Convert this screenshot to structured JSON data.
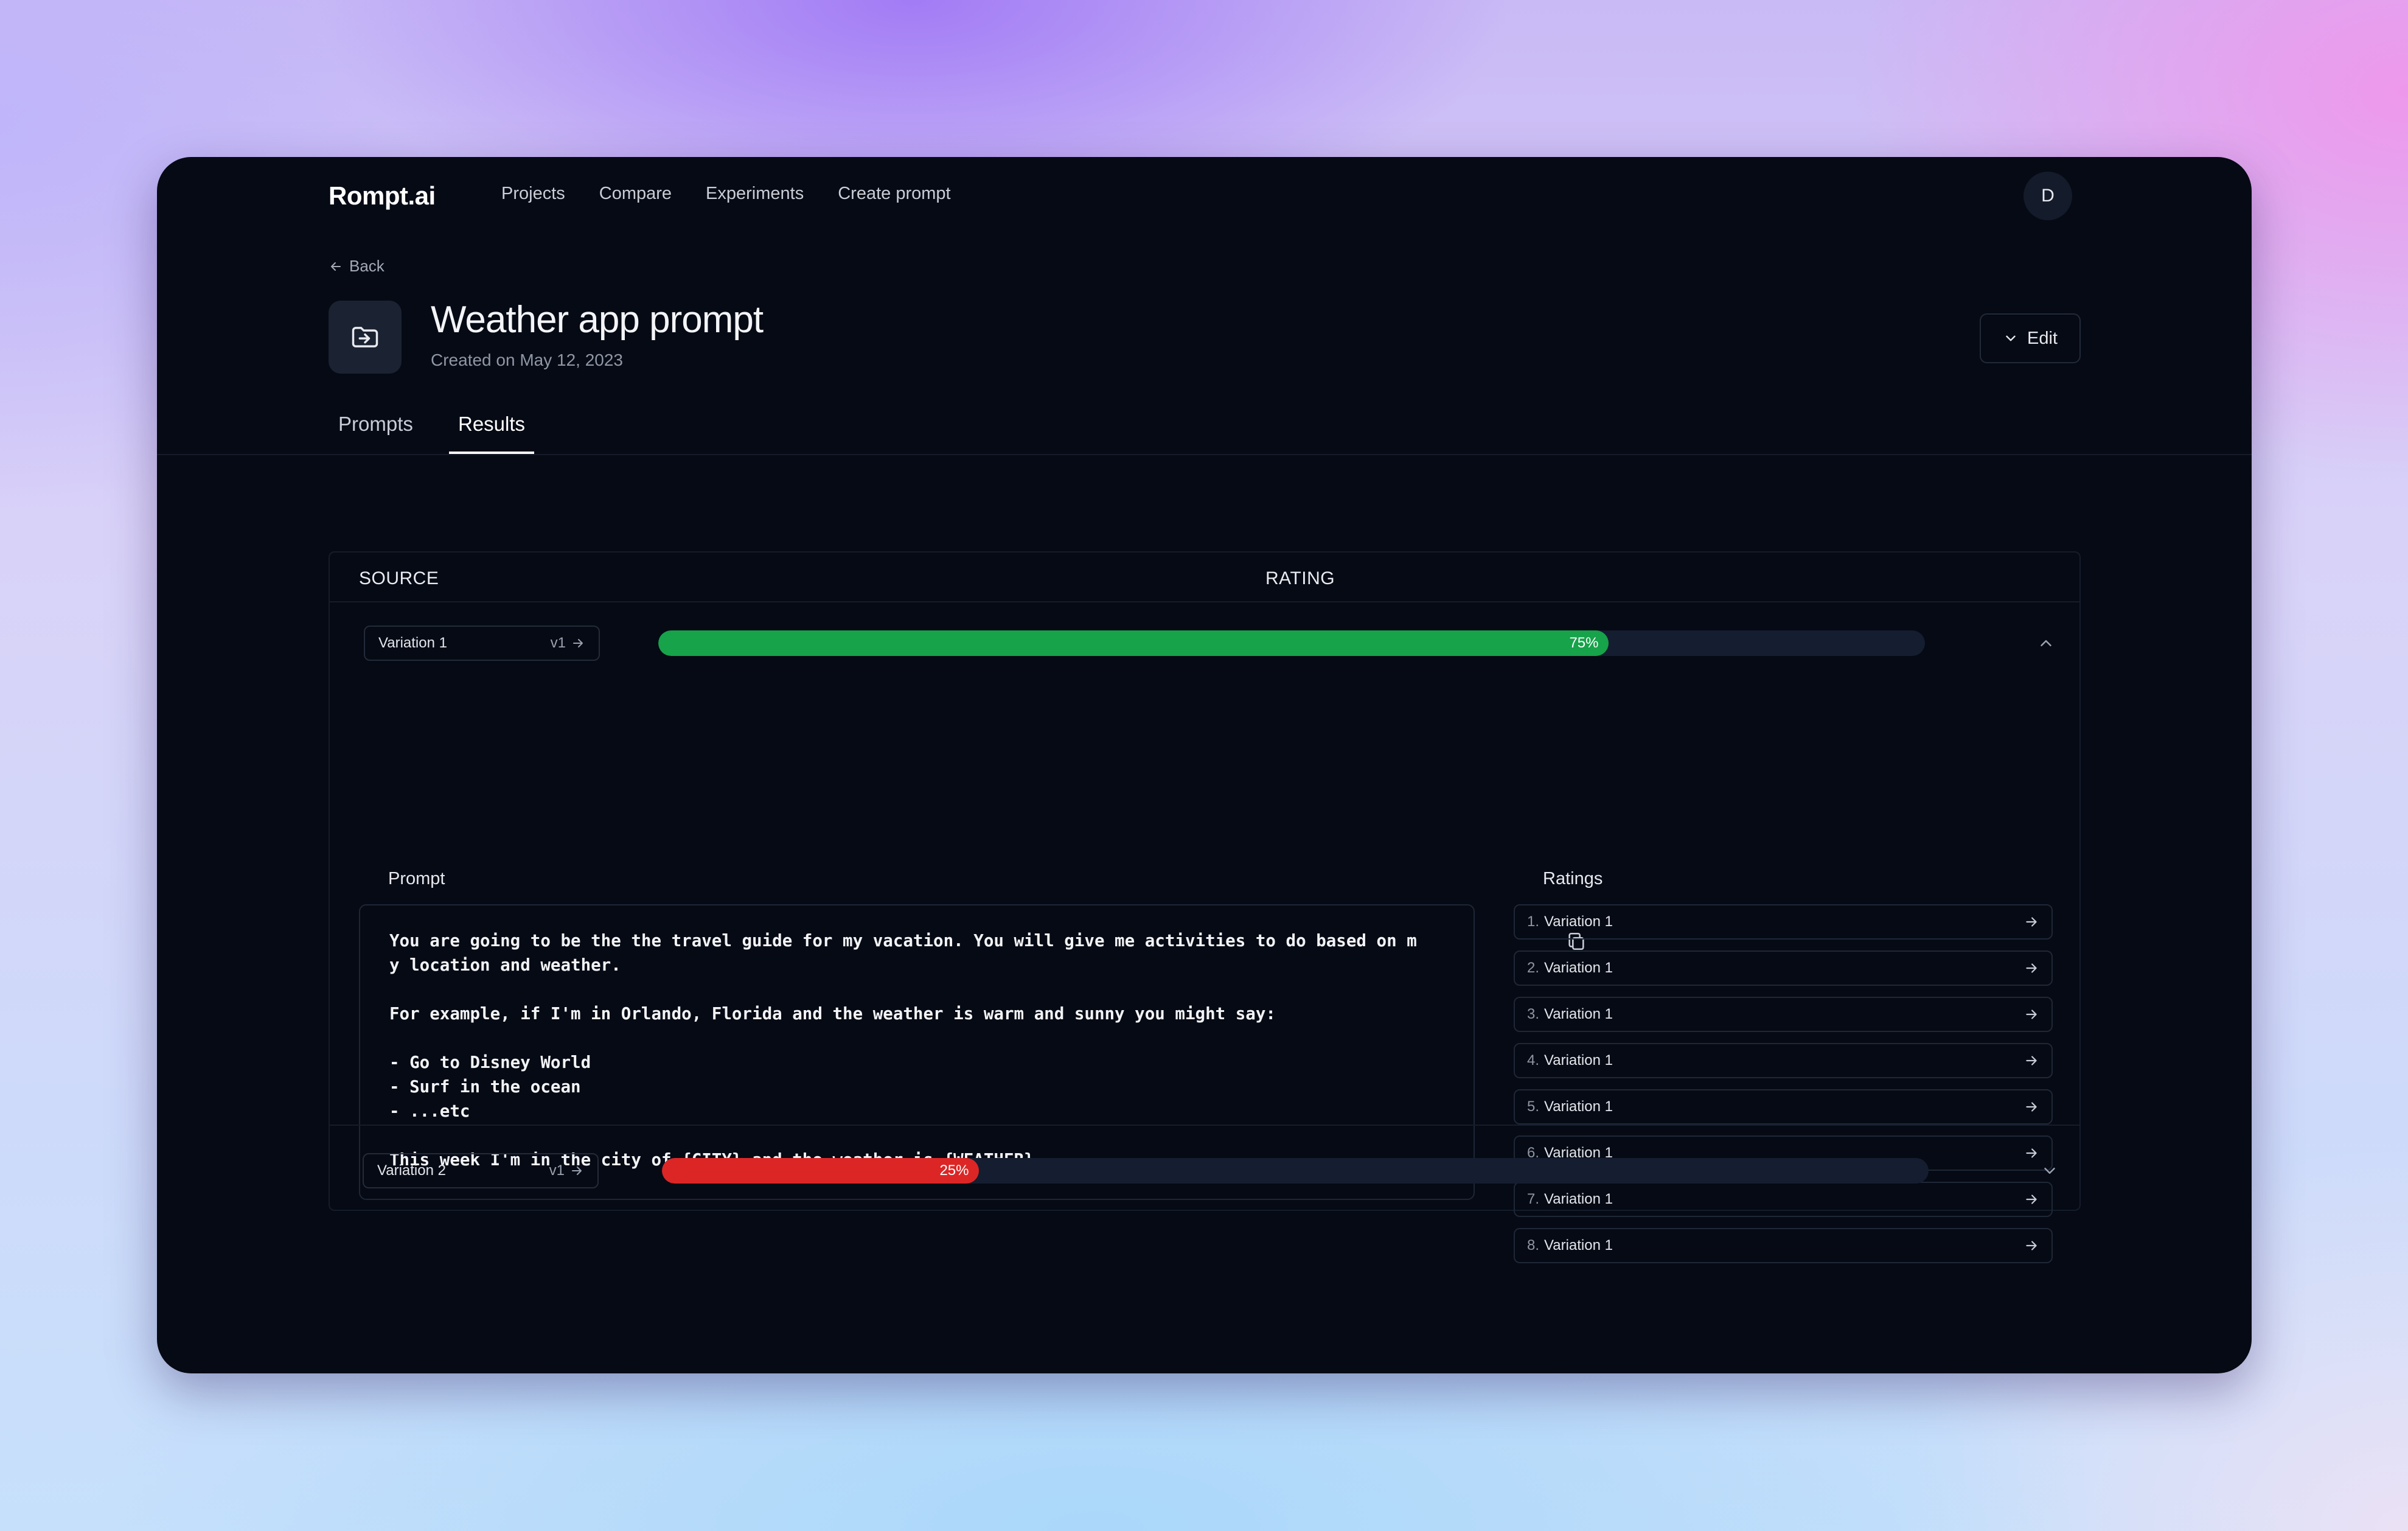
{
  "app": {
    "logo": "Rompt.ai",
    "nav": [
      "Projects",
      "Compare",
      "Experiments",
      "Create prompt"
    ],
    "avatar_initial": "D"
  },
  "page": {
    "back_label": "Back",
    "title": "Weather app prompt",
    "subtitle": "Created on May 12, 2023",
    "edit_label": "Edit",
    "tabs": [
      {
        "label": "Prompts",
        "active": false
      },
      {
        "label": "Results",
        "active": true
      }
    ]
  },
  "results": {
    "columns": {
      "source": "SOURCE",
      "rating": "RATING"
    },
    "rows": [
      {
        "variation": "Variation 1",
        "version": "v1",
        "rating_percent": 75,
        "rating_label": "75%",
        "bar_color": "#16a34a",
        "expanded": true
      },
      {
        "variation": "Variation 2",
        "version": "v1",
        "rating_percent": 25,
        "rating_label": "25%",
        "bar_color": "#dc2626",
        "expanded": false
      }
    ],
    "expanded": {
      "prompt_label": "Prompt",
      "ratings_label": "Ratings",
      "prompt_text": "You are going to be the the travel guide for my vacation. You will give me activities to do based on m\ny location and weather.\n\nFor example, if I'm in Orlando, Florida and the weather is warm and sunny you might say:\n\n- Go to Disney World\n- Surf in the ocean\n- ...etc\n\nThis week I'm in the city of {CITY} and the weather is {WEATHER}.",
      "ratings": [
        {
          "num": "1.",
          "label": "Variation 1"
        },
        {
          "num": "2.",
          "label": "Variation 1"
        },
        {
          "num": "3.",
          "label": "Variation 1"
        },
        {
          "num": "4.",
          "label": "Variation 1"
        },
        {
          "num": "5.",
          "label": "Variation 1"
        },
        {
          "num": "6.",
          "label": "Variation 1"
        },
        {
          "num": "7.",
          "label": "Variation 1"
        },
        {
          "num": "8.",
          "label": "Variation 1"
        }
      ]
    }
  },
  "icons": {
    "back": "arrow-left-icon",
    "project": "folder-import-icon",
    "edit": "chevron-down-icon",
    "version_arrow": "arrow-right-icon",
    "collapse": "chevron-up-icon",
    "expand": "chevron-down-icon",
    "copy": "copy-icon"
  }
}
